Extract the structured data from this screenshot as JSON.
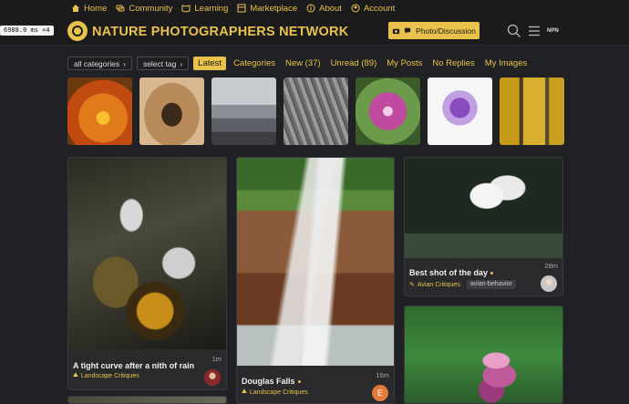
{
  "topnav": {
    "items": [
      {
        "label": "Home",
        "icon": "home-icon"
      },
      {
        "label": "Community",
        "icon": "chat-icon"
      },
      {
        "label": "Learning",
        "icon": "book-icon"
      },
      {
        "label": "Marketplace",
        "icon": "store-icon"
      },
      {
        "label": "About",
        "icon": "info-icon"
      },
      {
        "label": "Account",
        "icon": "user-icon"
      }
    ]
  },
  "header": {
    "zoom": "6988.0 ms ×4",
    "site_title": "NATURE PHOTOGRAPHERS NETWORK",
    "photo_button": "Photo/Discussion",
    "user_initials": "NPN"
  },
  "filters": {
    "category_dropdown": "all categories",
    "tag_dropdown": "select tag",
    "tabs": [
      {
        "label": "Latest",
        "active": true
      },
      {
        "label": "Categories",
        "active": false
      },
      {
        "label": "New (37)",
        "active": false
      },
      {
        "label": "Unread (89)",
        "active": false
      },
      {
        "label": "My Posts",
        "active": false
      },
      {
        "label": "No Replies",
        "active": false
      },
      {
        "label": "My Images",
        "active": false
      }
    ]
  },
  "colors": {
    "accent": "#e8c24a",
    "background": "#202124",
    "card": "#2a2a2d"
  },
  "cards": [
    {
      "title": "A tight curve after a nith of rain",
      "category": "Landscape Critiques",
      "time": "1m"
    },
    {
      "title": "Douglas Falls",
      "category": "Landscape Critiques",
      "time": "16m",
      "avatar_letter": "E"
    },
    {
      "title": "Best shot of the day",
      "category": "Avian Critiques",
      "tag": "avian-behavior",
      "time": "28m"
    }
  ]
}
